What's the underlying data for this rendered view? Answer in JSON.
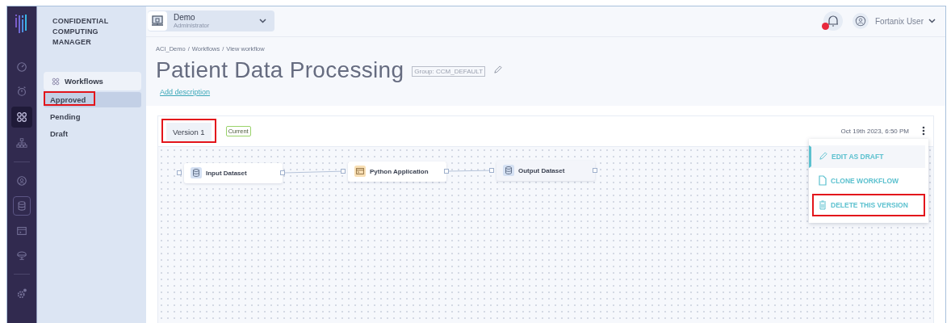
{
  "rail": {
    "groups": [
      [
        {
          "kind": "gauge",
          "selected": false,
          "focused": false
        },
        {
          "kind": "alarm",
          "selected": false,
          "focused": false
        },
        {
          "kind": "workflows",
          "selected": true,
          "focused": false
        },
        {
          "kind": "hierarchy",
          "selected": false,
          "focused": false
        }
      ],
      [
        {
          "kind": "user",
          "selected": false,
          "focused": false
        },
        {
          "kind": "database",
          "selected": false,
          "focused": true
        },
        {
          "kind": "terminal",
          "selected": false,
          "focused": false
        },
        {
          "kind": "laptop",
          "selected": false,
          "focused": false
        }
      ],
      [
        {
          "kind": "gear",
          "selected": false,
          "focused": false
        }
      ]
    ]
  },
  "sidebar": {
    "title": "CONFIDENTIAL COMPUTING MANAGER",
    "section": {
      "label": "Workflows",
      "items": [
        {
          "label": "Approved",
          "selected": true,
          "highlighted": true
        },
        {
          "label": "Pending",
          "selected": false,
          "highlighted": false
        },
        {
          "label": "Draft",
          "selected": false,
          "highlighted": false
        }
      ]
    }
  },
  "account": {
    "name": "Demo",
    "role": "Administrator"
  },
  "notifications": {
    "badge": true
  },
  "user": {
    "name": "Fortanix User"
  },
  "breadcrumb": {
    "items": [
      "ACI_Demo",
      "Workflows",
      "View workflow"
    ],
    "separator": "/"
  },
  "title": "Patient Data Processing",
  "group_tag": "Group: CCM_DEFAULT",
  "add_description": "Add description",
  "version": {
    "label": "Version 1",
    "highlighted": true,
    "badge": "Current",
    "date": "Oct 19th 2023, 6:50 PM"
  },
  "menu": [
    {
      "kind": "edit",
      "label": "EDIT AS DRAFT",
      "selected": true,
      "highlighted": false
    },
    {
      "kind": "clone",
      "label": "CLONE WORKFLOW",
      "selected": false,
      "highlighted": false
    },
    {
      "kind": "delete",
      "label": "DELETE THIS VERSION",
      "selected": false,
      "highlighted": true
    }
  ],
  "nodes": [
    {
      "kind": "dataset",
      "label": "Input Dataset",
      "dimmed": false
    },
    {
      "kind": "application",
      "label": "Python Application",
      "dimmed": false
    },
    {
      "kind": "dataset",
      "label": "Output Dataset",
      "dimmed": true
    }
  ]
}
